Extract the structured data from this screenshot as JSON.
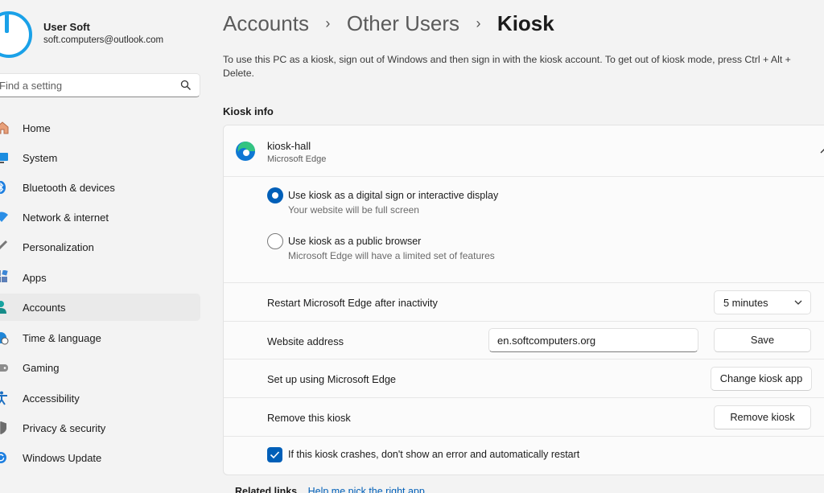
{
  "colors": {
    "accent": "#005fb8",
    "avatar": "#1aa1e8"
  },
  "user": {
    "name": "User Soft",
    "email": "soft.computers@outlook.com"
  },
  "search": {
    "placeholder": "Find a setting",
    "icon": "search-icon"
  },
  "nav": {
    "items": [
      {
        "label": "Home",
        "icon": "home-icon"
      },
      {
        "label": "System",
        "icon": "monitor-icon"
      },
      {
        "label": "Bluetooth & devices",
        "icon": "bluetooth-icon"
      },
      {
        "label": "Network & internet",
        "icon": "wifi-icon"
      },
      {
        "label": "Personalization",
        "icon": "brush-icon"
      },
      {
        "label": "Apps",
        "icon": "apps-icon"
      },
      {
        "label": "Accounts",
        "icon": "person-icon",
        "active": true
      },
      {
        "label": "Time & language",
        "icon": "globe-clock-icon"
      },
      {
        "label": "Gaming",
        "icon": "gamepad-icon"
      },
      {
        "label": "Accessibility",
        "icon": "accessibility-icon"
      },
      {
        "label": "Privacy & security",
        "icon": "shield-icon"
      },
      {
        "label": "Windows Update",
        "icon": "update-icon"
      }
    ]
  },
  "breadcrumb": {
    "items": [
      "Accounts",
      "Other Users"
    ],
    "current": "Kiosk",
    "separator": "›"
  },
  "description": "To use this PC as a kiosk, sign out of Windows and then sign in with the kiosk account. To get out of kiosk mode, press Ctrl + Alt + Delete.",
  "kiosk_info": {
    "title": "Kiosk info",
    "kiosk_name": "kiosk-hall",
    "kiosk_app": "Microsoft Edge",
    "options": [
      {
        "label": "Use kiosk as a digital sign or interactive display",
        "sub": "Your website will be full screen",
        "selected": true
      },
      {
        "label": "Use kiosk as a public browser",
        "sub": "Microsoft Edge will have a limited set of features",
        "selected": false
      }
    ],
    "restart": {
      "label": "Restart Microsoft Edge after inactivity",
      "value": "5 minutes"
    },
    "website": {
      "label": "Website address",
      "value": "en.softcomputers.org",
      "save_label": "Save"
    },
    "setup": {
      "label": "Set up using Microsoft Edge",
      "button_label": "Change kiosk app"
    },
    "remove": {
      "label": "Remove this kiosk",
      "button_label": "Remove kiosk"
    },
    "crash": {
      "label": "If this kiosk crashes, don't show an error and automatically restart",
      "checked": true
    }
  },
  "related": {
    "title": "Related links",
    "link": "Help me pick the right app"
  }
}
